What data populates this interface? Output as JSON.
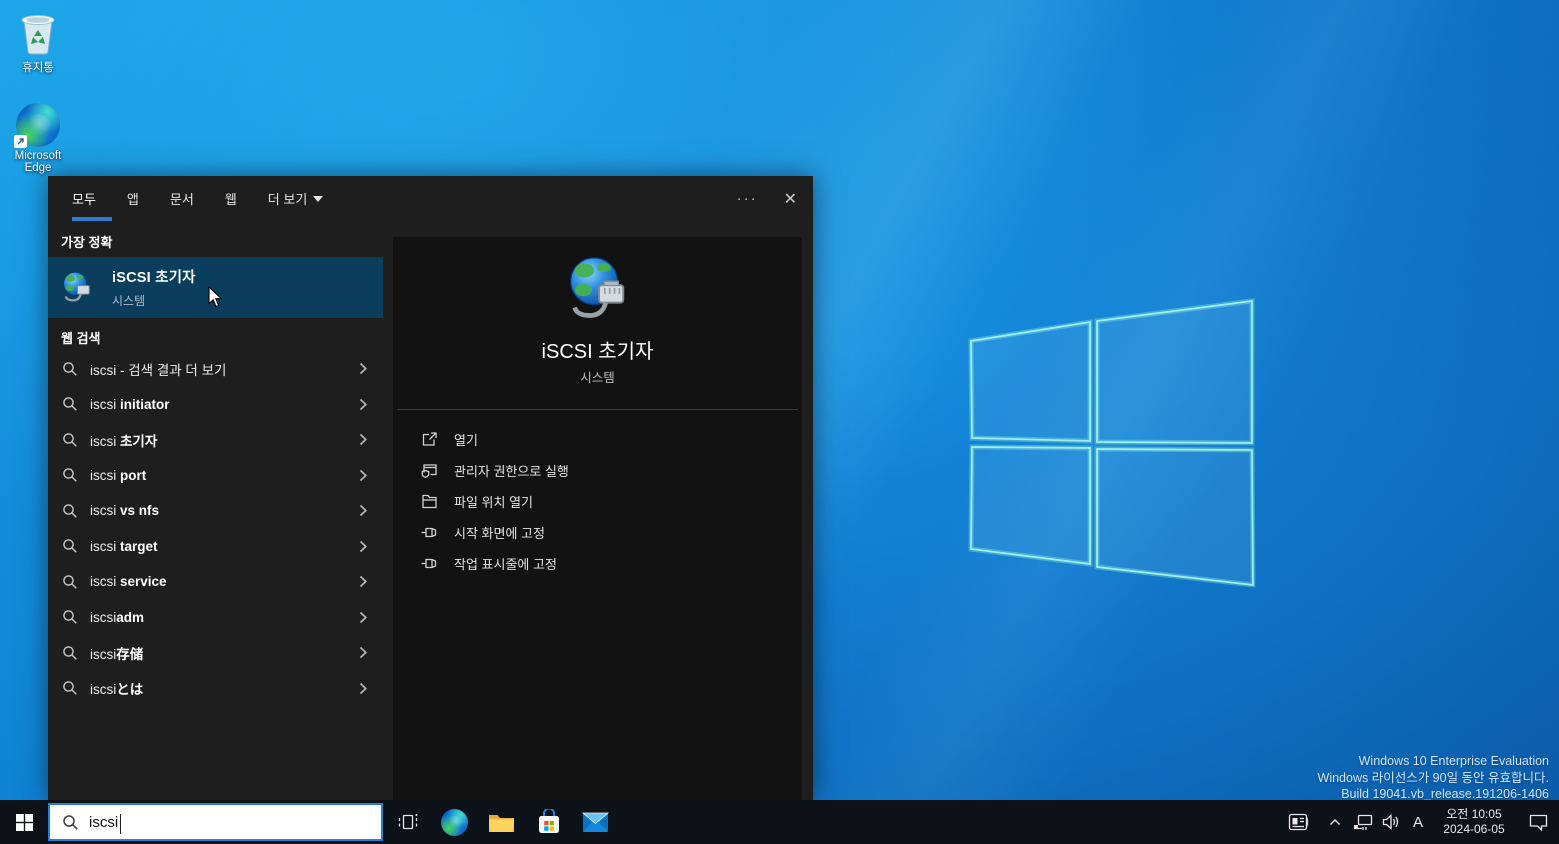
{
  "desktop": {
    "recycle_bin_label": "휴지통",
    "edge_label_line1": "Microsoft",
    "edge_label_line2": "Edge",
    "watermark_line1": "Windows 10 Enterprise Evaluation",
    "watermark_line2": "Windows 라이선스가 90일 동안 유효합니다.",
    "watermark_line3": "Build 19041.vb_release.191206-1406"
  },
  "search_panel": {
    "tabs": {
      "all": "모두",
      "apps": "앱",
      "documents": "문서",
      "web": "웹",
      "more": "더 보기"
    },
    "controls": {
      "more_options": "···",
      "close": "✕"
    },
    "best_match_header": "가장 정확",
    "best_match": {
      "title": "iSCSI 초기자",
      "subtitle": "시스템"
    },
    "web_search_header": "웹 검색",
    "suggestions": [
      {
        "text": "iscsi - 검색 결과 더 보기",
        "bold": ""
      },
      {
        "text": "iscsi ",
        "bold": "initiator"
      },
      {
        "text": "iscsi ",
        "bold": "초기자"
      },
      {
        "text": "iscsi ",
        "bold": "port"
      },
      {
        "text": "iscsi ",
        "bold": "vs nfs"
      },
      {
        "text": "iscsi ",
        "bold": "target"
      },
      {
        "text": "iscsi ",
        "bold": "service"
      },
      {
        "text": "iscsi",
        "bold": "adm"
      },
      {
        "text": "iscsi",
        "bold": "存储"
      },
      {
        "text": "iscsi",
        "bold": "とは"
      }
    ],
    "preview": {
      "title": "iSCSI 초기자",
      "subtitle": "시스템",
      "actions": [
        {
          "label": "열기"
        },
        {
          "label": "관리자 권한으로 실행"
        },
        {
          "label": "파일 위치 열기"
        },
        {
          "label": "시작 화면에 고정"
        },
        {
          "label": "작업 표시줄에 고정"
        }
      ]
    }
  },
  "taskbar": {
    "search_value": "iscsi",
    "ime_indicator": "A",
    "time": "오전 10:05",
    "date": "2024-06-05"
  }
}
